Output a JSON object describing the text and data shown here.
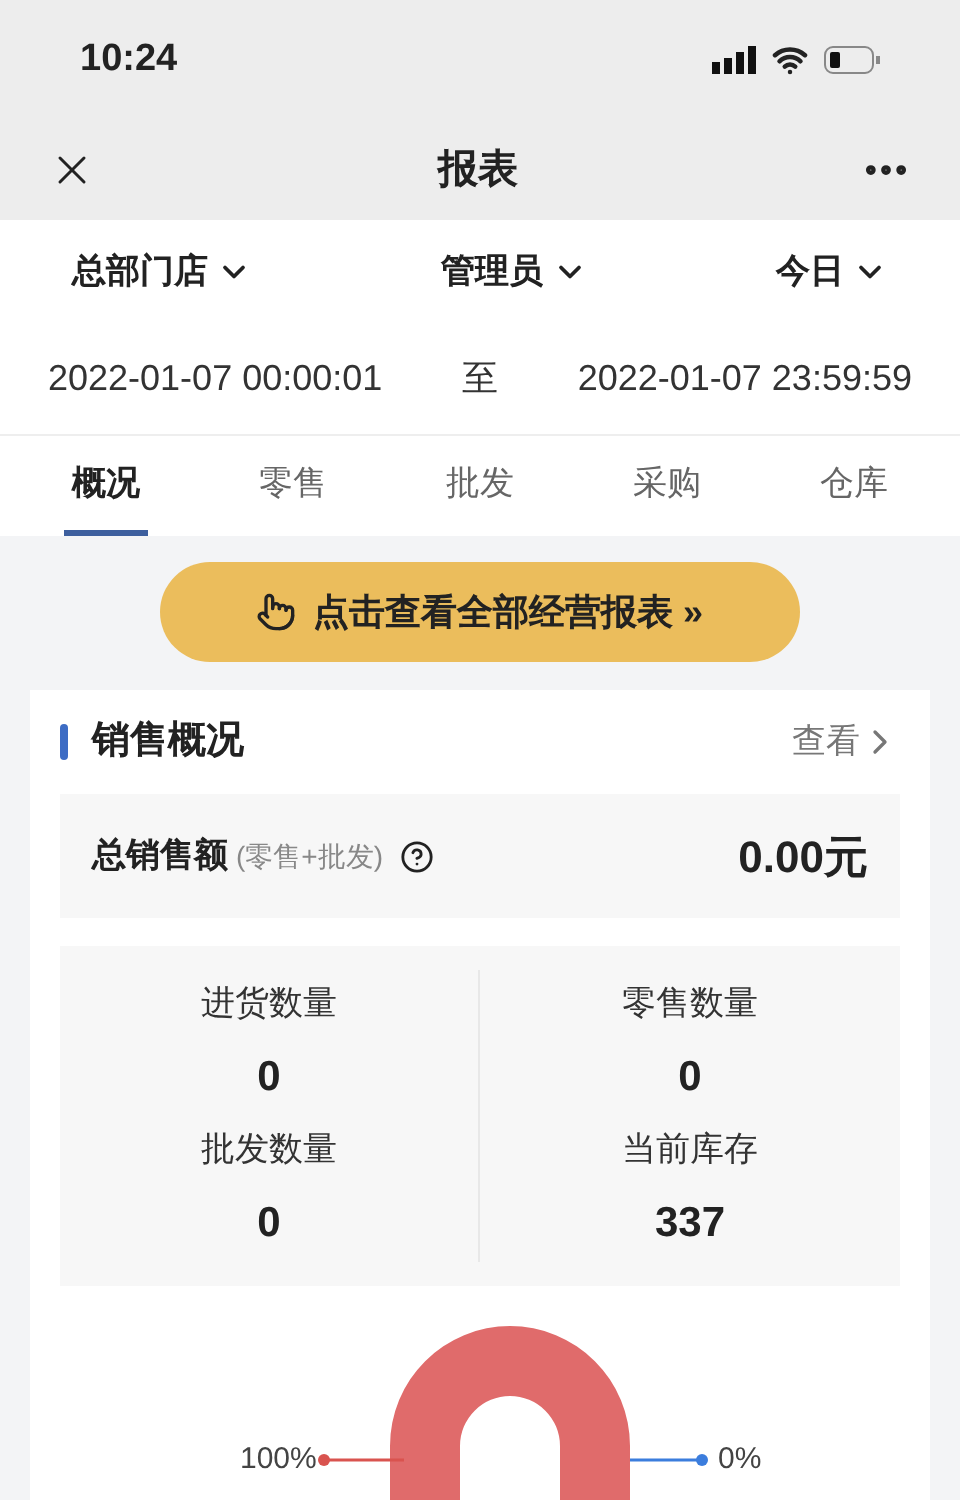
{
  "status_bar": {
    "time": "10:24"
  },
  "nav": {
    "title": "报表"
  },
  "filters": [
    {
      "label": "总部门店"
    },
    {
      "label": "管理员"
    },
    {
      "label": "今日"
    }
  ],
  "date_range": {
    "start": "2022-01-07 00:00:01",
    "separator": "至",
    "end": "2022-01-07 23:59:59"
  },
  "tabs": [
    {
      "label": "概况",
      "selected": true
    },
    {
      "label": "零售",
      "selected": false
    },
    {
      "label": "批发",
      "selected": false
    },
    {
      "label": "采购",
      "selected": false
    },
    {
      "label": "仓库",
      "selected": false
    }
  ],
  "banner_button": {
    "label": "点击查看全部经营报表",
    "arrow": "»"
  },
  "sales_card": {
    "title": "销售概况",
    "link": "查看",
    "total": {
      "label": "总销售额",
      "note": "(零售+批发)",
      "value": "0.00元"
    },
    "stats": [
      {
        "label": "进货数量",
        "value": "0"
      },
      {
        "label": "零售数量",
        "value": "0"
      },
      {
        "label": "批发数量",
        "value": "0"
      },
      {
        "label": "当前库存",
        "value": "337"
      }
    ],
    "chart_labels": [
      {
        "text": "100%",
        "color": "#d9534f"
      },
      {
        "text": "0%",
        "color": "#3b7ddd"
      }
    ]
  }
}
